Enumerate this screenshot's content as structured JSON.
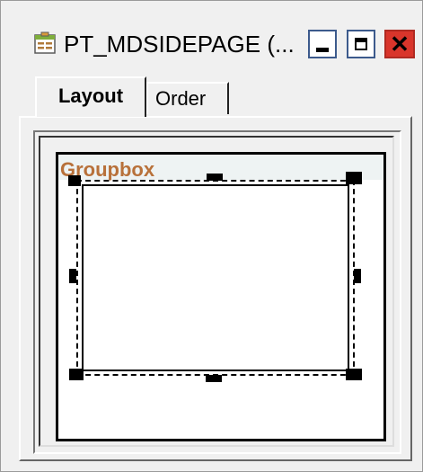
{
  "window": {
    "title": "PT_MDSIDEPAGE (...",
    "icon": "page-definition-icon",
    "buttons": {
      "minimize": "minimize-icon",
      "maximize": "maximize-icon",
      "close": "close-icon",
      "close_glyph": "✕"
    }
  },
  "tabs": [
    {
      "label": "Layout",
      "selected": true
    },
    {
      "label": "Order",
      "selected": false
    }
  ],
  "canvas": {
    "groupbox": {
      "label": "Groupbox"
    }
  },
  "colors": {
    "groupbox_label": "#b8713a",
    "close_button": "#d9352b",
    "window_button_border": "#3c5a8c"
  }
}
